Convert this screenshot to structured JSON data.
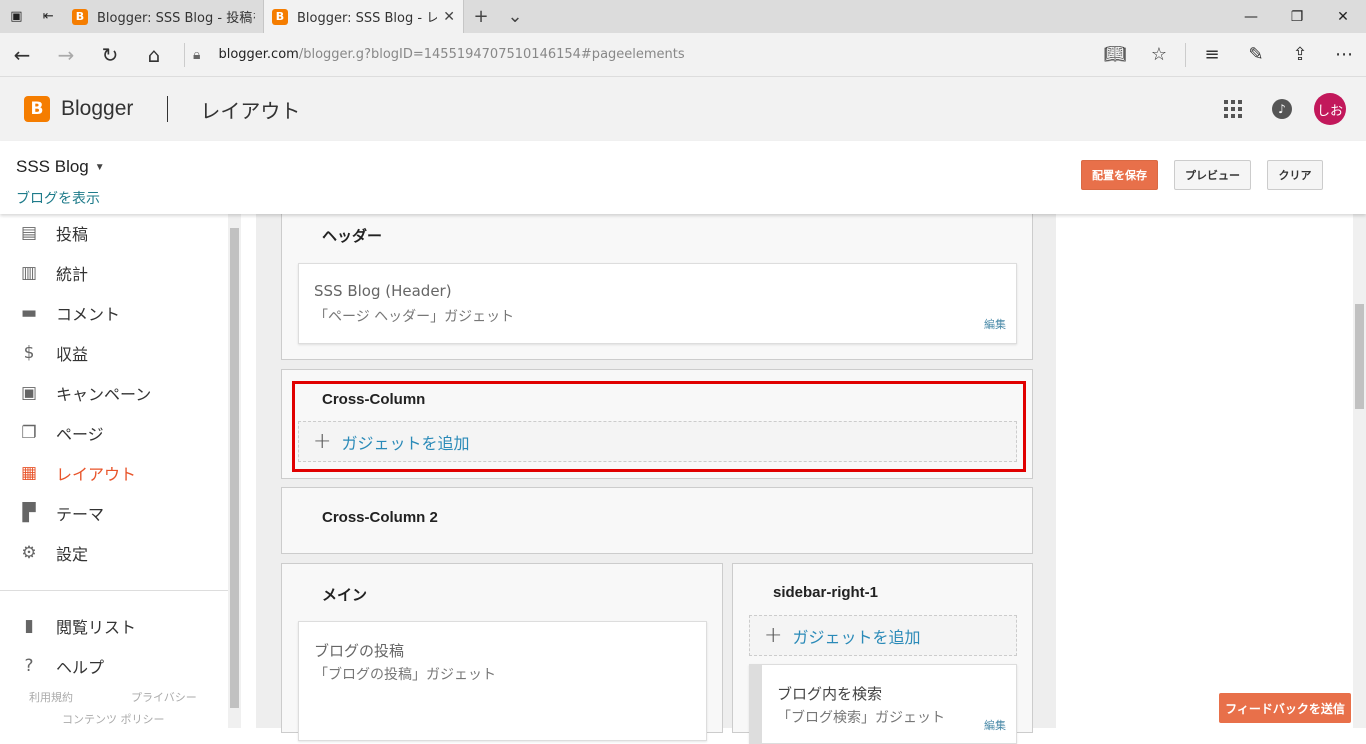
{
  "browser": {
    "tabs": [
      {
        "title": "Blogger: SSS Blog - 投稿を編"
      },
      {
        "title": "Blogger: SSS Blog - レイ"
      }
    ],
    "url_host": "blogger.com",
    "url_path": "/blogger.g?blogID=1455194707510146154#pageelements"
  },
  "header": {
    "brand": "Blogger",
    "page_title": "レイアウト",
    "avatar_text": "しお"
  },
  "blogbar": {
    "blog_name": "SSS Blog",
    "view_blog": "ブログを表示",
    "save_label": "配置を保存",
    "preview_label": "プレビュー",
    "clear_label": "クリア"
  },
  "sidebar": {
    "items": [
      {
        "label": "投稿",
        "icon": "posts-icon"
      },
      {
        "label": "統計",
        "icon": "stats-icon"
      },
      {
        "label": "コメント",
        "icon": "comments-icon"
      },
      {
        "label": "収益",
        "icon": "earnings-icon"
      },
      {
        "label": "キャンペーン",
        "icon": "campaigns-icon"
      },
      {
        "label": "ページ",
        "icon": "pages-icon"
      },
      {
        "label": "レイアウト",
        "icon": "layout-icon"
      },
      {
        "label": "テーマ",
        "icon": "theme-icon"
      },
      {
        "label": "設定",
        "icon": "settings-icon"
      },
      {
        "label": "閲覧リスト",
        "icon": "reading-list-icon"
      },
      {
        "label": "ヘルプ",
        "icon": "help-icon"
      }
    ],
    "footer": {
      "terms": "利用規約",
      "privacy": "プライバシー",
      "content_policy": "コンテンツ ポリシー"
    }
  },
  "layout": {
    "header_section": {
      "title": "ヘッダー",
      "gadget_name": "SSS Blog (Header)",
      "gadget_type": "「ページ ヘッダー」ガジェット",
      "edit": "編集"
    },
    "cross_column": {
      "title": "Cross-Column",
      "add_gadget": "ガジェットを追加"
    },
    "cross_column_2": {
      "title": "Cross-Column 2"
    },
    "main_section": {
      "title": "メイン",
      "gadget_name": "ブログの投稿",
      "gadget_type": "「ブログの投稿」ガジェット"
    },
    "sidebar_right": {
      "title": "sidebar-right-1",
      "add_gadget": "ガジェットを追加",
      "gadget_name": "ブログ内を検索",
      "gadget_type": "「ブログ検索」ガジェット",
      "edit": "編集"
    }
  },
  "feedback_label": "フィードバックを送信",
  "colors": {
    "accent": "#e8704a",
    "active_nav": "#e8542a",
    "highlight_border": "#e00000",
    "link": "#2a8ab8"
  }
}
